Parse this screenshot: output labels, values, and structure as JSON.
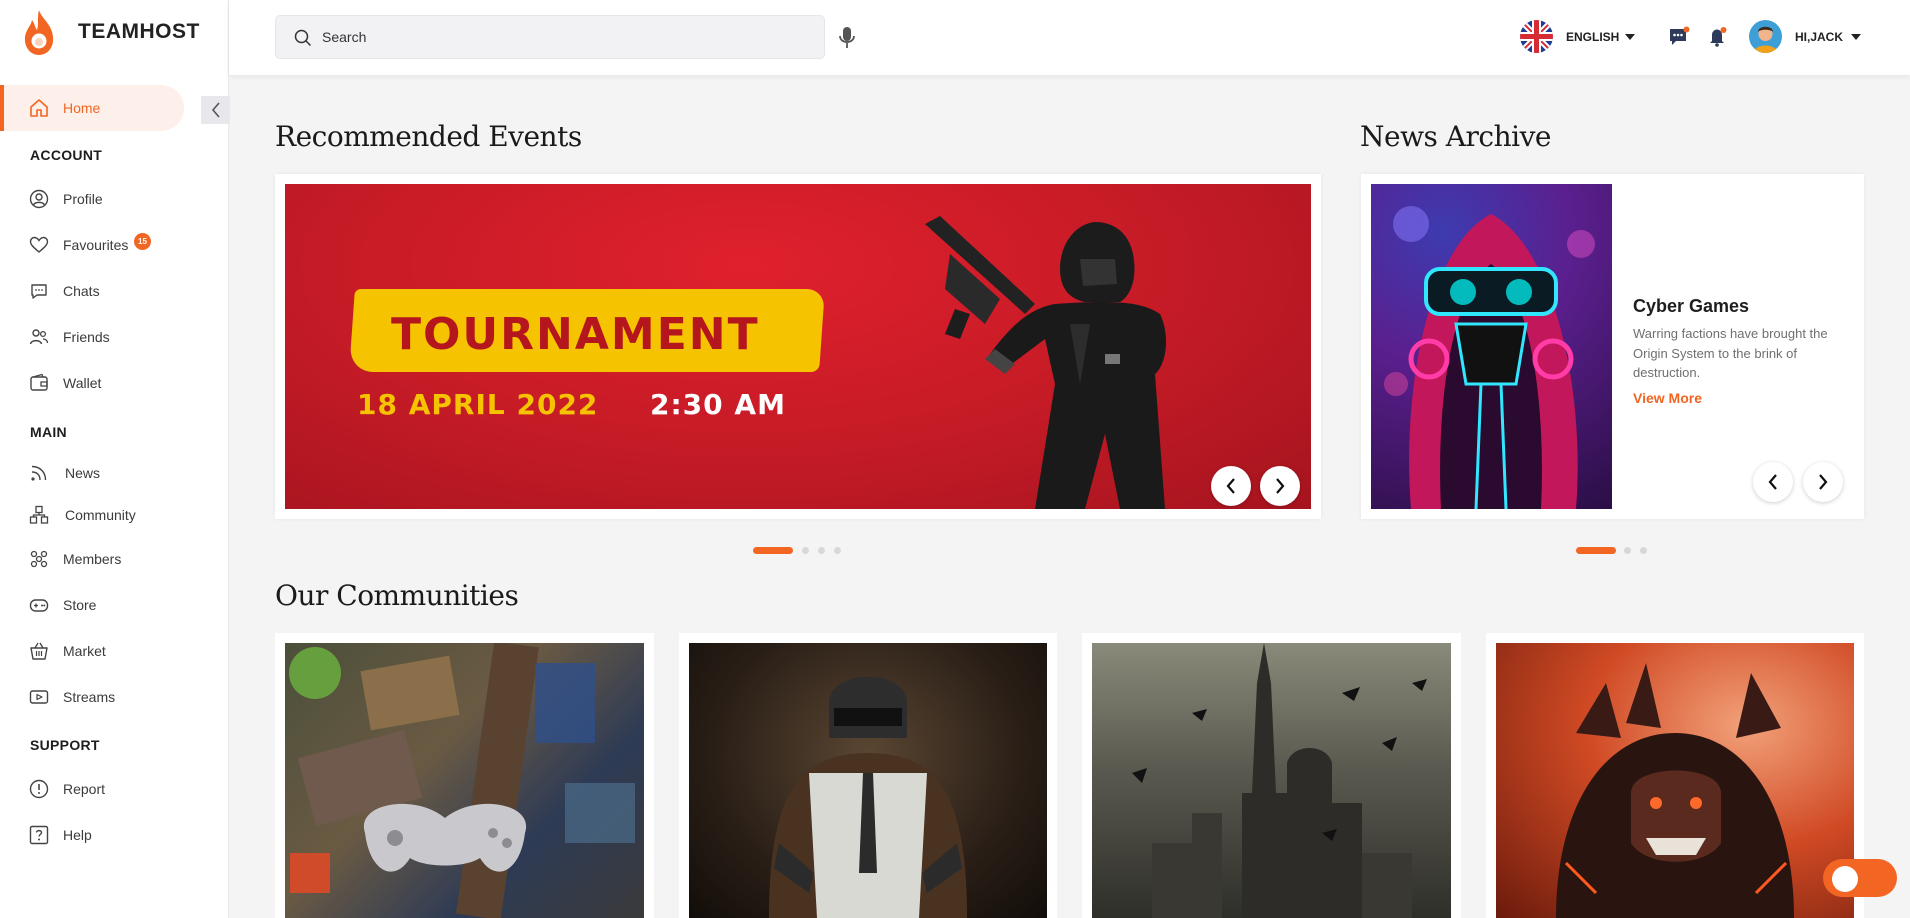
{
  "app": {
    "name": "TEAMHOST"
  },
  "sidebar": {
    "home_label": "Home",
    "sections": {
      "account": "ACCOUNT",
      "main": "MAIN",
      "support": "SUPPORT"
    },
    "account_items": [
      {
        "label": "Profile",
        "icon": "user-circle-icon"
      },
      {
        "label": "Favourites",
        "icon": "heart-icon",
        "badge": "15"
      },
      {
        "label": "Chats",
        "icon": "chat-icon"
      },
      {
        "label": "Friends",
        "icon": "friends-icon"
      },
      {
        "label": "Wallet",
        "icon": "wallet-icon"
      }
    ],
    "main_items": [
      {
        "label": "News",
        "icon": "rss-icon"
      },
      {
        "label": "Community",
        "icon": "community-icon"
      },
      {
        "label": "Members",
        "icon": "members-icon"
      },
      {
        "label": "Store",
        "icon": "gamepad-icon"
      },
      {
        "label": "Market",
        "icon": "basket-icon"
      },
      {
        "label": "Streams",
        "icon": "streams-icon"
      }
    ],
    "support_items": [
      {
        "label": "Report",
        "icon": "alert-icon"
      },
      {
        "label": "Help",
        "icon": "help-icon"
      }
    ]
  },
  "header": {
    "search_placeholder": "Search",
    "language": "ENGLISH",
    "user_greeting": "HI,JACK"
  },
  "events": {
    "title": "Recommended Events",
    "banner": {
      "headline": "TOURNAMENT",
      "date": "18 APRIL 2022",
      "time": "2:30 AM"
    },
    "slides_count": 4,
    "active_slide": 1
  },
  "news": {
    "title": "News Archive",
    "item_title": "Cyber Games",
    "item_desc": "Warring factions have brought the Origin System to the brink of destruction.",
    "view_more": "View More",
    "slides_count": 3,
    "active_slide": 1
  },
  "communities": {
    "title": "Our Communities"
  },
  "colors": {
    "accent": "#f26522",
    "banner_red": "#c41b26",
    "banner_yellow": "#f6c300"
  }
}
